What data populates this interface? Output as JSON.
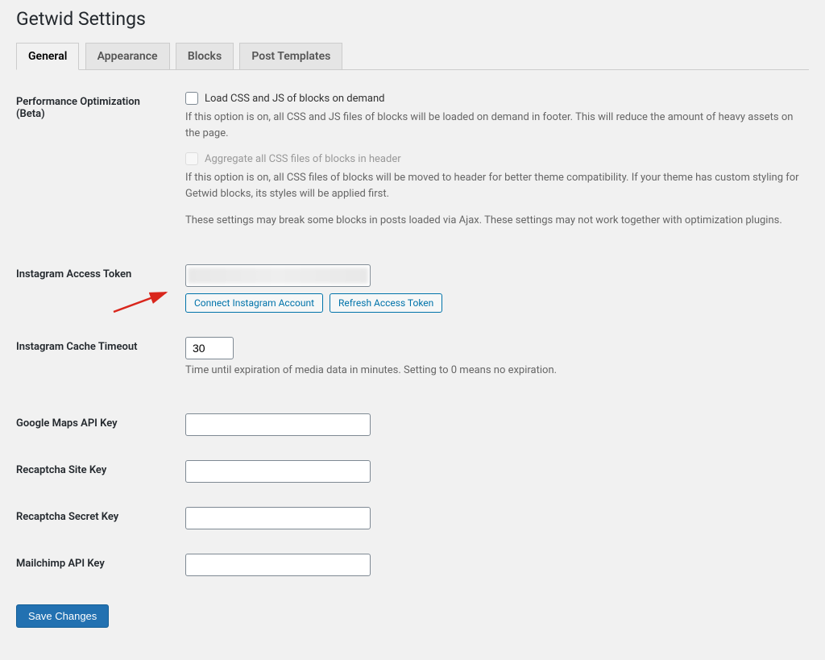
{
  "header": {
    "title": "Getwid Settings"
  },
  "tabs": [
    {
      "label": "General",
      "active": true
    },
    {
      "label": "Appearance",
      "active": false
    },
    {
      "label": "Blocks",
      "active": false
    },
    {
      "label": "Post Templates",
      "active": false
    }
  ],
  "performance": {
    "label": "Performance Optimization (Beta)",
    "opt1_label": "Load CSS and JS of blocks on demand",
    "opt1_desc": "If this option is on, all CSS and JS files of blocks will be loaded on demand in footer. This will reduce the amount of heavy assets on the page.",
    "opt2_label": "Aggregate all CSS files of blocks in header",
    "opt2_desc": "If this option is on, all CSS files of blocks will be moved to header for better theme compatibility. If your theme has custom styling for Getwid blocks, its styles will be applied first.",
    "note": "These settings may break some blocks in posts loaded via Ajax. These settings may not work together with optimization plugins."
  },
  "instagram_token": {
    "label": "Instagram Access Token",
    "connect_btn": "Connect Instagram Account",
    "refresh_btn": "Refresh Access Token"
  },
  "instagram_cache": {
    "label": "Instagram Cache Timeout",
    "value": "30",
    "desc": "Time until expiration of media data in minutes. Setting to 0 means no expiration."
  },
  "gmaps": {
    "label": "Google Maps API Key",
    "value": ""
  },
  "recaptcha_site": {
    "label": "Recaptcha Site Key",
    "value": ""
  },
  "recaptcha_secret": {
    "label": "Recaptcha Secret Key",
    "value": ""
  },
  "mailchimp": {
    "label": "Mailchimp API Key",
    "value": ""
  },
  "save_button": "Save Changes",
  "colors": {
    "primary": "#2271b1",
    "link": "#0073aa",
    "arrow": "#d9261c"
  }
}
